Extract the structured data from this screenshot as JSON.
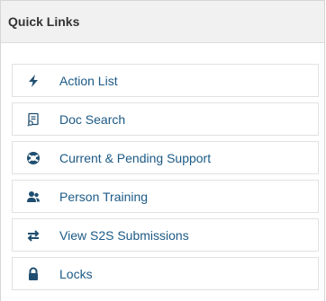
{
  "panel": {
    "title": "Quick Links",
    "items": [
      {
        "label": "Action List",
        "icon": "bolt-icon"
      },
      {
        "label": "Doc Search",
        "icon": "document-search-icon"
      },
      {
        "label": "Current & Pending Support",
        "icon": "life-ring-icon"
      },
      {
        "label": "Person Training",
        "icon": "users-icon"
      },
      {
        "label": "View S2S Submissions",
        "icon": "exchange-arrows-icon"
      },
      {
        "label": "Locks",
        "icon": "lock-icon"
      }
    ]
  },
  "colors": {
    "header_bg": "#f1f1f1",
    "link_text": "#1c5a86",
    "icon": "#1f4e70"
  }
}
